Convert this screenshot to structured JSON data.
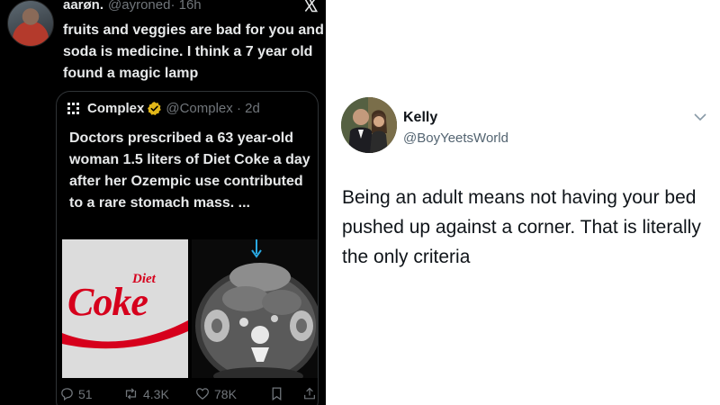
{
  "left_tweet": {
    "author_name": "aarøn.",
    "author_handle": "@ayroned",
    "timestamp": "· 16h",
    "text": "fruits and veggies are bad for you and soda is medicine. I think a 7 year old found a magic lamp",
    "quote": {
      "name": "Complex",
      "handle_time": "@Complex · 2d",
      "text": "Doctors prescribed a 63 year-old woman 1.5 liters of Diet Coke a day after her Ozempic use contributed to a rare stomach mass. ...",
      "image_left_text": {
        "diet": "Diet",
        "brand": "Coke"
      }
    },
    "actions": {
      "replies": "51",
      "reposts": "4.3K",
      "likes": "78K"
    }
  },
  "right_tweet": {
    "author_name": "Kelly",
    "author_handle": "@BoyYeetsWorld",
    "text": "Being an adult means not having your bed pushed up against a corner. That is literally the only criteria"
  },
  "colors": {
    "dark_bg": "#000000",
    "dark_text": "#e7e9ea",
    "muted": "#71767b",
    "verified_gold": "#e2b719",
    "coke_red": "#d6001c",
    "light_text": "#0f1419",
    "light_muted": "#536471"
  },
  "icons": [
    "x-logo-icon",
    "verified-badge-icon",
    "complex-logo-icon",
    "reply-icon",
    "repost-icon",
    "like-icon",
    "bookmark-icon",
    "share-icon",
    "chevron-down-icon",
    "ct-arrow-icon"
  ]
}
